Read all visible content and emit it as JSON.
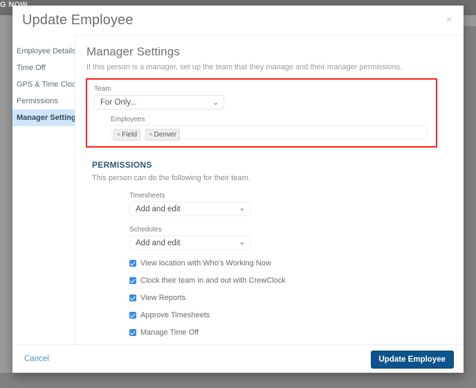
{
  "background": {
    "page_title_fragment": "G NOW"
  },
  "modal": {
    "title": "Update Employee",
    "close_label": "×",
    "sidebar": {
      "items": [
        {
          "label": "Employee Details",
          "active": false
        },
        {
          "label": "Time Off",
          "active": false
        },
        {
          "label": "GPS & Time Clock",
          "active": false
        },
        {
          "label": "Permissions",
          "active": false
        },
        {
          "label": "Manager Settings",
          "active": true
        }
      ]
    },
    "content": {
      "heading": "Manager Settings",
      "description": "If this person is a manager, set up the team that they manage and their manager permissions.",
      "team": {
        "label": "Team",
        "value": "For Only...",
        "chevron": "⌄"
      },
      "employees": {
        "label": "Employees",
        "tags": [
          {
            "remove": "×",
            "label": "Field"
          },
          {
            "remove": "×",
            "label": "Denver"
          }
        ]
      },
      "permissions": {
        "heading": "PERMISSIONS",
        "description": "This person can do the following for their team.",
        "selects": [
          {
            "label": "Timesheets",
            "value": "Add and edit"
          },
          {
            "label": "Schedules",
            "value": "Add and edit"
          }
        ],
        "checkboxes": [
          {
            "label": "View location with Who's Working Now",
            "checked": true
          },
          {
            "label": "Clock their team in and out with CrewClock",
            "checked": true
          },
          {
            "label": "View Reports",
            "checked": true
          },
          {
            "label": "Approve Timesheets",
            "checked": true
          },
          {
            "label": "Manage Time Off",
            "checked": true
          }
        ]
      }
    },
    "footer": {
      "cancel_label": "Cancel",
      "submit_label": "Update Employee"
    }
  },
  "colors": {
    "accent_blue": "#0e538c",
    "highlight_red": "#ff1c1c",
    "sidebar_active": "#cfe5f8",
    "checkbox_blue": "#3b8bea",
    "link_blue": "#4a8fd0",
    "permissions_heading": "#2d5578"
  }
}
